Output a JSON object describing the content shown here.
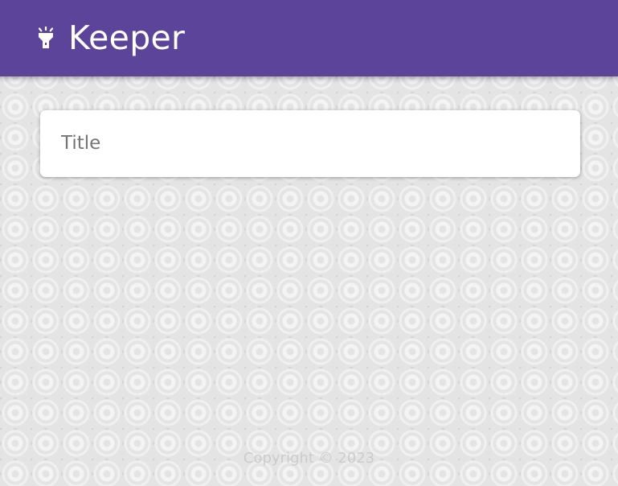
{
  "header": {
    "title": "Keeper",
    "icon": "flashlight-icon",
    "background_color": "#5b4499"
  },
  "note_form": {
    "title_placeholder": "Title",
    "title_value": ""
  },
  "footer": {
    "copyright": "Copyright © 2023"
  }
}
